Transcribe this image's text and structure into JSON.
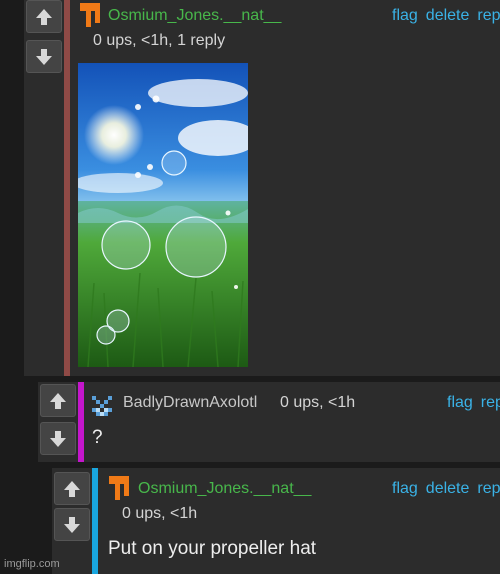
{
  "comments": [
    {
      "username": "Osmium_Jones.__nat__",
      "meta": "0 ups, <1h, 1 reply",
      "actions": [
        "flag",
        "delete",
        "rep"
      ],
      "attachment": "image",
      "user_color": "#48b74b",
      "bar_color": "#8f4a46"
    },
    {
      "username": "BadlyDrawnAxolotl",
      "meta": "0 ups, <1h",
      "actions": [
        "flag",
        "rep"
      ],
      "text": "?",
      "user_color": "#c7c7c7",
      "bar_color": "#c416cc"
    },
    {
      "username": "Osmium_Jones.__nat__",
      "meta": "0 ups, <1h",
      "actions": [
        "flag",
        "delete",
        "rep"
      ],
      "text": "Put on your propeller hat",
      "user_color": "#48b74b",
      "bar_color": "#19a6df"
    }
  ],
  "icons": [
    "upvote-arrow-icon",
    "downvote-arrow-icon",
    "orange-blocky-avatar-icon",
    "blue-pixel-avatar-icon"
  ],
  "watermark": "imgflip.com"
}
